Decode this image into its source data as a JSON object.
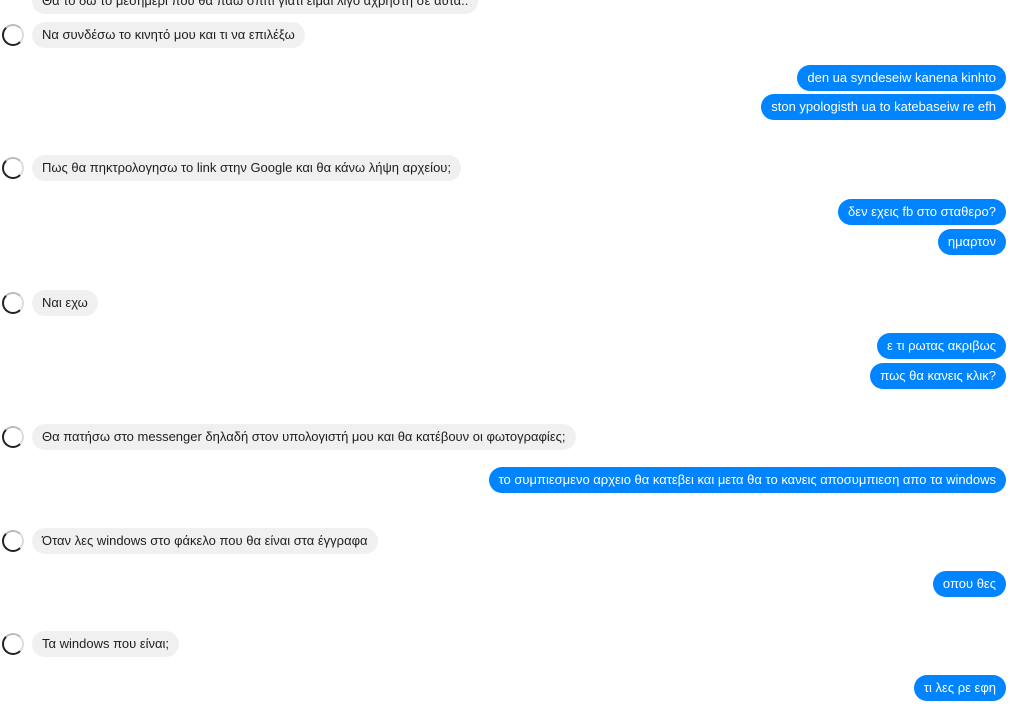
{
  "conversation": {
    "messages": [
      {
        "side": "in",
        "text": "Θα το δω το μεσημέρι που θα πάω σπίτι γιατί είμαι λίγο άχρηστη σε αυτά.."
      },
      {
        "side": "in",
        "text": "Να συνδέσω το κινητό μου και τι να επιλέξω"
      },
      {
        "side": "out",
        "text": "den ua syndeseiw kanena kinhto"
      },
      {
        "side": "out",
        "text": "ston ypologisth ua to katebaseiw re efh"
      },
      {
        "side": "in",
        "text": "Πως θα πηκτρολογησω το link στην Google και θα κάνω λήψη αρχείου;"
      },
      {
        "side": "out",
        "text": "δεν εχεις fb στο σταθερο?"
      },
      {
        "side": "out",
        "text": "ημαρτον"
      },
      {
        "side": "in",
        "text": "Ναι εχω"
      },
      {
        "side": "out",
        "text": "ε τι ρωτας ακριβως"
      },
      {
        "side": "out",
        "text": "πως θα κανεις κλικ?"
      },
      {
        "side": "in",
        "text": "Θα πατήσω στο messenger δηλαδή στον υπολογιστή μου και θα κατέβουν οι φωτογραφίες;"
      },
      {
        "side": "out",
        "text": "το συμπιεσμενο αρχειο θα κατεβει και μετα θα το κανεις αποσυμπιεση απο τα windows"
      },
      {
        "side": "in",
        "text": "Όταν λες windows στο φάκελο που θα είναι στα έγγραφα"
      },
      {
        "side": "out",
        "text": "οπου θες"
      },
      {
        "side": "in",
        "text": "Τα windows που είναι;"
      },
      {
        "side": "out",
        "text": "τι λες ρε εφη"
      }
    ]
  },
  "colors": {
    "incoming_bubble": "#f1f0f0",
    "outgoing_bubble": "#0084ff",
    "incoming_text": "#1c1e21",
    "outgoing_text": "#ffffff"
  },
  "icons": {
    "contact_avatar": "contact-avatar-icon"
  }
}
